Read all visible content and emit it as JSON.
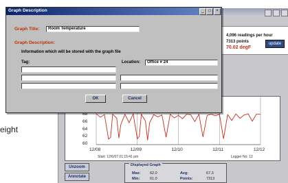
{
  "side_text": "eight",
  "dialog": {
    "title": "Graph Description",
    "graph_title_label": "Graph Title:",
    "graph_title_value": "Room Temperature",
    "graph_description_label": "Graph Description:",
    "info_text": "Information which will be stored with the graph file",
    "tag_label": "Tag:",
    "tag_value": "",
    "location_label": "Location:",
    "location_value": "Office # 24",
    "ok_label": "OK",
    "cancel_label": "Cancel"
  },
  "app": {
    "readings_text": "4,096 readings per hour",
    "points_text": "7313 points",
    "current_value": "70.02 degF",
    "update_label": "update",
    "unzoom_label": "Unzoom",
    "annotate_label": "Annotate",
    "start_text": "Start: 12/6/07 01:15:41 pm",
    "logger_text": "Logger No:    13",
    "displayed_graph": {
      "title": "Displayed Graph",
      "max_label": "Max:",
      "max_value": "62.0",
      "avg_label": "Avg:",
      "avg_value": "67.3",
      "min_label": "Min:",
      "min_value": "61.0",
      "points_label": "Points:",
      "points_value": "7313"
    }
  },
  "chart_data": {
    "type": "line",
    "x_ticks": [
      "12/08",
      "12/09",
      "12/10",
      "12/11",
      "12/12"
    ],
    "y_ticks": [
      "68",
      "66",
      "64",
      "62",
      "60"
    ],
    "ylim": [
      60,
      69
    ],
    "series": [
      {
        "x": [
          0,
          0.1,
          0.2,
          0.3,
          0.35,
          0.4,
          0.5,
          0.55,
          0.6,
          0.7,
          0.8,
          0.9,
          1.0,
          1.05,
          1.1,
          1.2,
          1.25,
          1.3,
          1.4,
          1.5,
          1.6,
          1.7,
          1.8,
          1.9,
          2.0,
          2.1,
          2.2,
          2.3,
          2.4,
          2.5,
          2.6,
          2.7,
          2.8,
          2.9,
          3.0,
          3.1,
          3.2,
          3.3,
          3.4,
          3.5,
          3.6,
          3.7,
          3.8,
          3.9,
          4.0
        ],
        "values": [
          68.4,
          67.5,
          68.2,
          61.5,
          62.0,
          68.3,
          67.2,
          61.8,
          65.5,
          68.3,
          66.0,
          68.4,
          61.6,
          62.3,
          68.3,
          66.4,
          61.2,
          66.0,
          68.2,
          67.6,
          68.1,
          62.0,
          68.3,
          67.3,
          68.0,
          67.1,
          68.3,
          68.2,
          66.3,
          68.3,
          62.1,
          68.0,
          68.3,
          67.9,
          68.3,
          61.6,
          68.2,
          66.6,
          68.4,
          67.2,
          68.1,
          68.4,
          66.4,
          68.3,
          68.3
        ]
      }
    ],
    "colors": {
      "line": "#cc2a1a"
    }
  }
}
